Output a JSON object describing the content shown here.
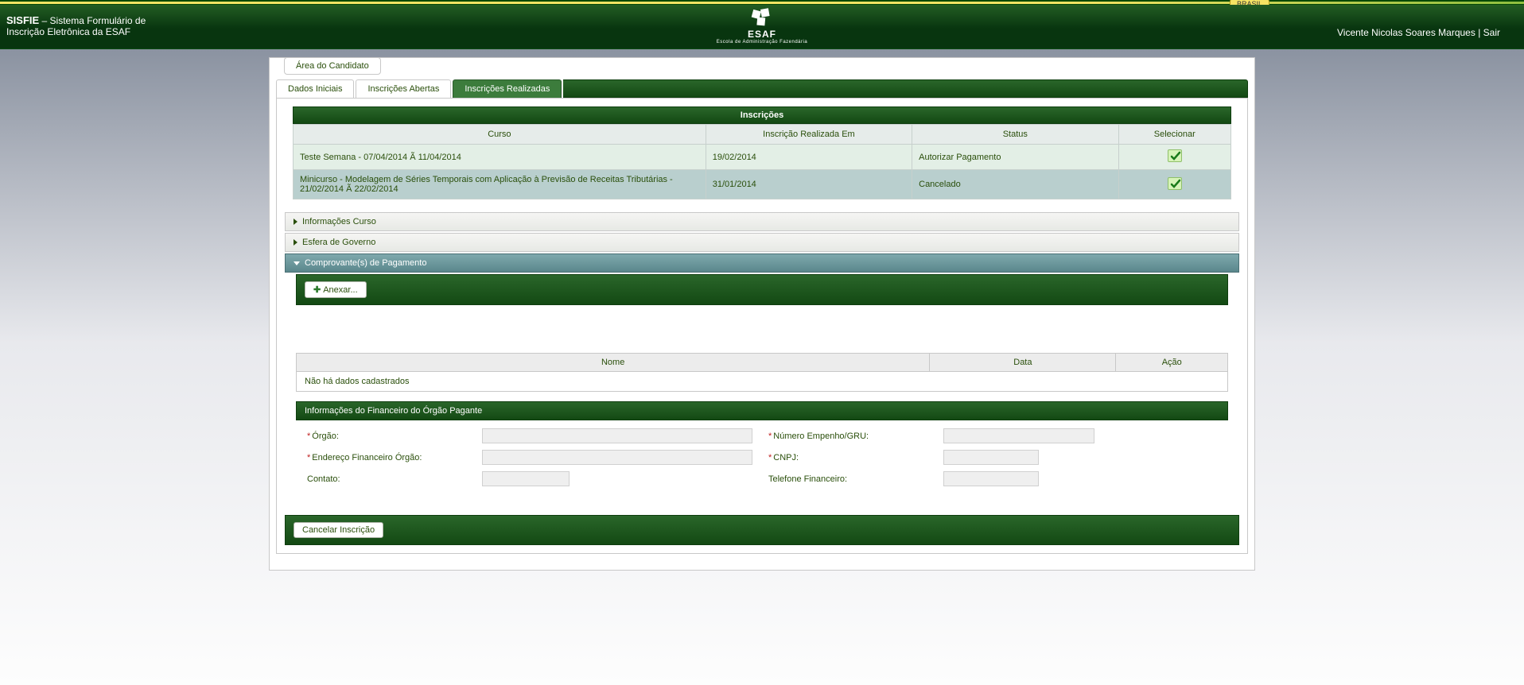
{
  "app": {
    "title_bold": "SISFIE",
    "title_rest": " – Sistema Formulário de",
    "title_line2": "Inscrição Eletrônica da ESAF",
    "logo_caption": "ESAF",
    "logo_sub": "Escola de Administração Fazendária",
    "user_name": "Vicente Nicolas Soares Marques",
    "separator": " | ",
    "logout": "Sair",
    "brasil": "BRASIL"
  },
  "fieldset_label": "Área do Candidato",
  "tabs": {
    "t0": "Dados Iniciais",
    "t1": "Inscrições Abertas",
    "t2": "Inscrições Realizadas"
  },
  "inscricoes": {
    "title": "Inscrições",
    "cols": {
      "curso": "Curso",
      "data": "Inscrição Realizada Em",
      "status": "Status",
      "sel": "Selecionar"
    },
    "rows": [
      {
        "curso": "Teste Semana - 07/04/2014 Ã  11/04/2014",
        "data": "19/02/2014",
        "status": "Autorizar Pagamento"
      },
      {
        "curso": "Minicurso - Modelagem de Séries Temporais com Aplicação à Previsão de Receitas Tributárias - 21/02/2014 Ã  22/02/2014",
        "data": "31/01/2014",
        "status": "Cancelado"
      }
    ]
  },
  "accordion": {
    "a0": "Informações Curso",
    "a1": "Esfera de Governo",
    "a2": "Comprovante(s) de Pagamento"
  },
  "anexar_label": "Anexar...",
  "attach_table": {
    "cols": {
      "nome": "Nome",
      "data": "Data",
      "acao": "Ação"
    },
    "empty": "Não há dados cadastrados"
  },
  "financeiro": {
    "title": "Informações do Financeiro do Órgão Pagante",
    "orgao": "Órgão:",
    "numero": "Número Empenho/GRU:",
    "endereco": "Endereço Financeiro Órgão:",
    "cnpj": "CNPJ:",
    "contato": "Contato:",
    "telefone": "Telefone Financeiro:"
  },
  "footer_btn": "Cancelar Inscrição"
}
